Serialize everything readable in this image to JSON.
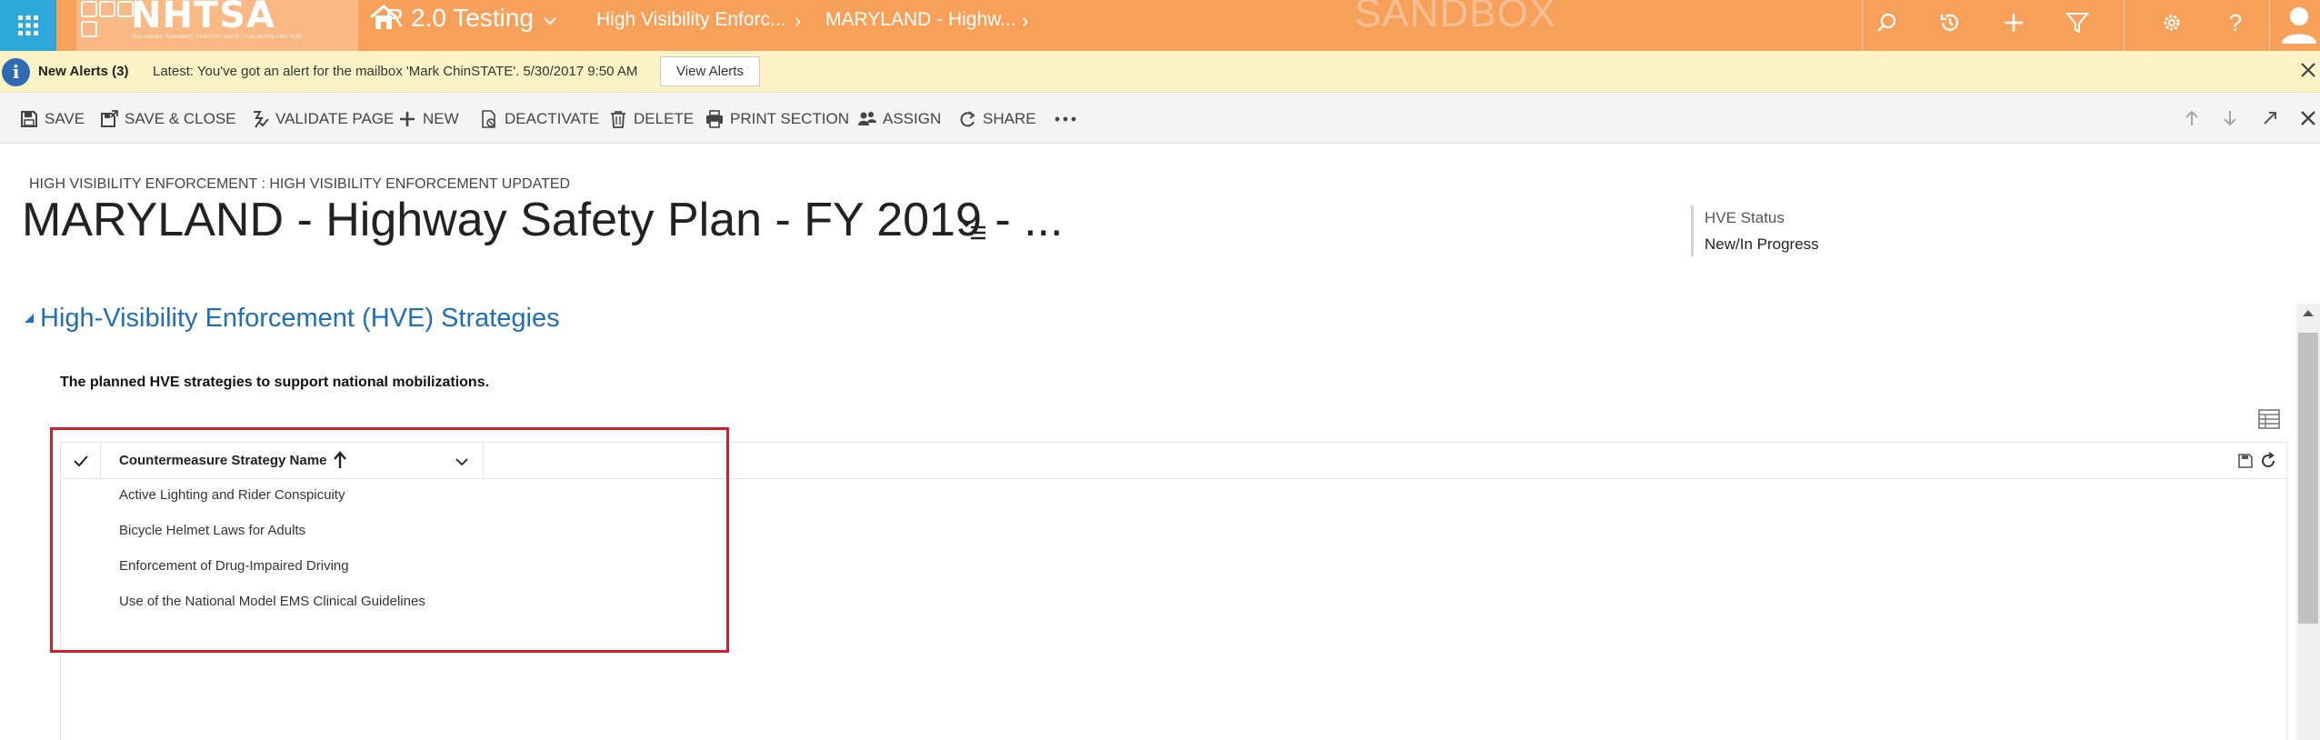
{
  "topnav": {
    "logo_text": "NHTSA",
    "logo_subtitle": "NATIONAL HIGHWAY TRAFFIC SAFETY ADMINISTRATION",
    "environment": "R 2.0 Testing",
    "breadcrumbs": [
      "High Visibility Enforc...",
      "MARYLAND - Highw..."
    ],
    "watermark": "SANDBOX",
    "icons": [
      "waffle-icon",
      "home-icon",
      "search-icon",
      "history-icon",
      "plus-icon",
      "filter-icon",
      "gear-icon",
      "help-icon",
      "user-avatar-icon"
    ],
    "accent_color": "#f7a05a",
    "waffle_color": "#2ea8d8"
  },
  "alerts": {
    "title": "New Alerts (3)",
    "message": "Latest: You've got an alert for the mailbox 'Mark ChinSTATE'. 5/30/2017 9:50 AM",
    "button": "View Alerts",
    "background_color": "#fbf3c5"
  },
  "commands": [
    {
      "label": "SAVE",
      "icon": "save-icon"
    },
    {
      "label": "SAVE & CLOSE",
      "icon": "save-close-icon"
    },
    {
      "label": "VALIDATE PAGE",
      "icon": "validate-icon"
    },
    {
      "label": "NEW",
      "icon": "plus-icon"
    },
    {
      "label": "DEACTIVATE",
      "icon": "deactivate-icon"
    },
    {
      "label": "DELETE",
      "icon": "trash-icon"
    },
    {
      "label": "PRINT SECTION",
      "icon": "print-icon"
    },
    {
      "label": "ASSIGN",
      "icon": "assign-icon"
    },
    {
      "label": "SHARE",
      "icon": "share-icon"
    }
  ],
  "header": {
    "entity_path": "HIGH VISIBILITY ENFORCEMENT : HIGH VISIBILITY ENFORCEMENT UPDATED",
    "title": "MARYLAND - Highway Safety Plan - FY 2019 - ...",
    "status_label": "HVE Status",
    "status_value": "New/In Progress"
  },
  "section": {
    "title": "High-Visibility Enforcement (HVE) Strategies",
    "description": "The planned HVE strategies to support national mobilizations.",
    "title_color": "#1f6fb8"
  },
  "grid": {
    "columns": [
      "Countermeasure Strategy Name"
    ],
    "rows": [
      "Active Lighting and Rider Conspicuity",
      "Bicycle Helmet Laws for Adults",
      "Enforcement of Drug-Impaired Driving",
      "Use of the National Model EMS Clinical Guidelines"
    ],
    "highlight_color": "#d81b25"
  }
}
